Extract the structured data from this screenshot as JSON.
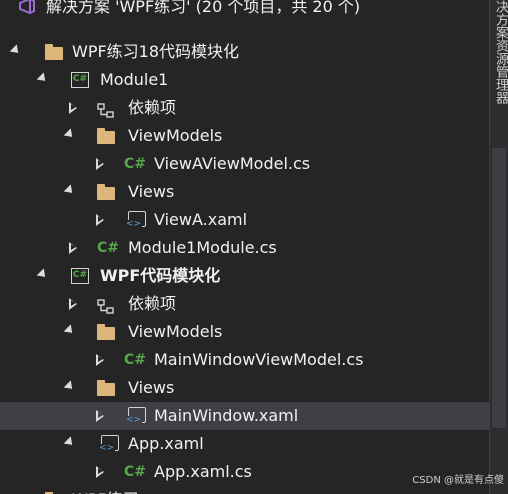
{
  "solution": {
    "label": "解决方案 'WPF练习' (20 个项目，共 20 个)"
  },
  "rows": [
    {
      "label": "WPF练习18代码模块化"
    },
    {
      "label": "Module1"
    },
    {
      "label": "依赖项"
    },
    {
      "label": "ViewModels"
    },
    {
      "label": "ViewAViewModel.cs"
    },
    {
      "label": "Views"
    },
    {
      "label": "ViewA.xaml"
    },
    {
      "label": "Module1Module.cs"
    },
    {
      "label": "WPF代码模块化"
    },
    {
      "label": "依赖项"
    },
    {
      "label": "ViewModels"
    },
    {
      "label": "MainWindowViewModel.cs"
    },
    {
      "label": "Views"
    },
    {
      "label": "MainWindow.xaml"
    },
    {
      "label": "App.xaml"
    },
    {
      "label": "App.xaml.cs"
    },
    {
      "label": "WPF练习"
    }
  ],
  "sidetab": {
    "label": "决方案资源管理器"
  },
  "watermark": "CSDN @就是有点傻",
  "colors": {
    "background": "#252526",
    "selected": "#3f3f46",
    "folder": "#dcb67a",
    "csharp": "#57a64a",
    "vs_logo": "#9b6bd6"
  },
  "icons": [
    "solution-icon",
    "folder-icon",
    "csproj-icon",
    "dependencies-icon",
    "csharp-file-icon",
    "xaml-file-icon",
    "expand-arrow-icon",
    "collapse-arrow-icon"
  ]
}
